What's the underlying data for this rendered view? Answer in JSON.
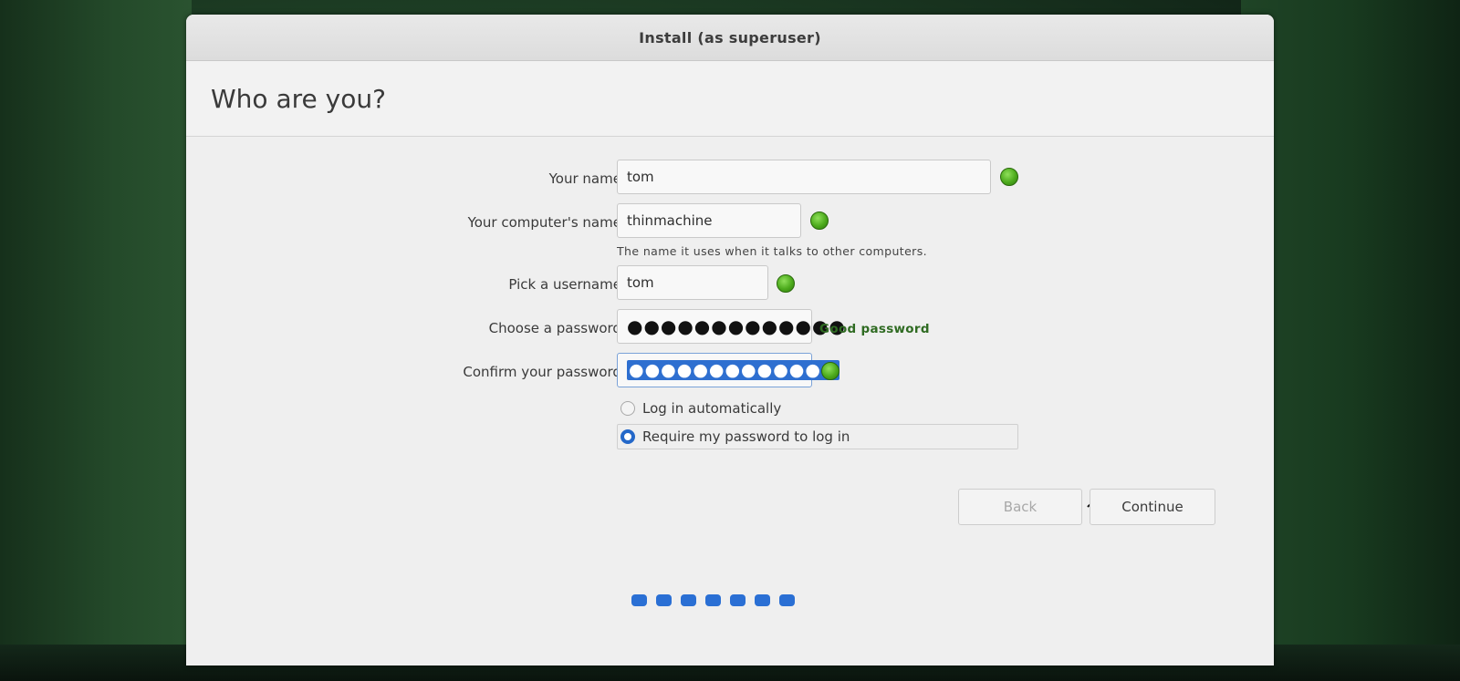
{
  "window": {
    "title": "Install (as superuser)"
  },
  "page": {
    "heading": "Who are you?"
  },
  "form": {
    "name_label": "Your name:",
    "name_value": "tom",
    "computer_label": "Your computer's name:",
    "computer_value": "thinmachine",
    "computer_hint": "The name it uses when it talks to other computers.",
    "username_label": "Pick a username:",
    "username_value": "tom",
    "password_label": "Choose a password:",
    "password_value": "●●●●●●●●●●●●●",
    "password_strength": "Good password",
    "confirm_label": "Confirm your password:",
    "confirm_value": "●●●●●●●●●●●●●",
    "login_auto_label": "Log in automatically",
    "login_require_label": "Require my password to log in",
    "selected_login_option": "Require my password to log in"
  },
  "buttons": {
    "back": "Back",
    "continue": "Continue"
  },
  "progress": {
    "steps": 7
  },
  "colors": {
    "accent": "#2a6fd4",
    "ok": "#4caa1c",
    "strength_text": "#2f6b22"
  },
  "icons": {
    "status": "check-ok-icon",
    "cursor": "mouse-pointer-icon"
  }
}
